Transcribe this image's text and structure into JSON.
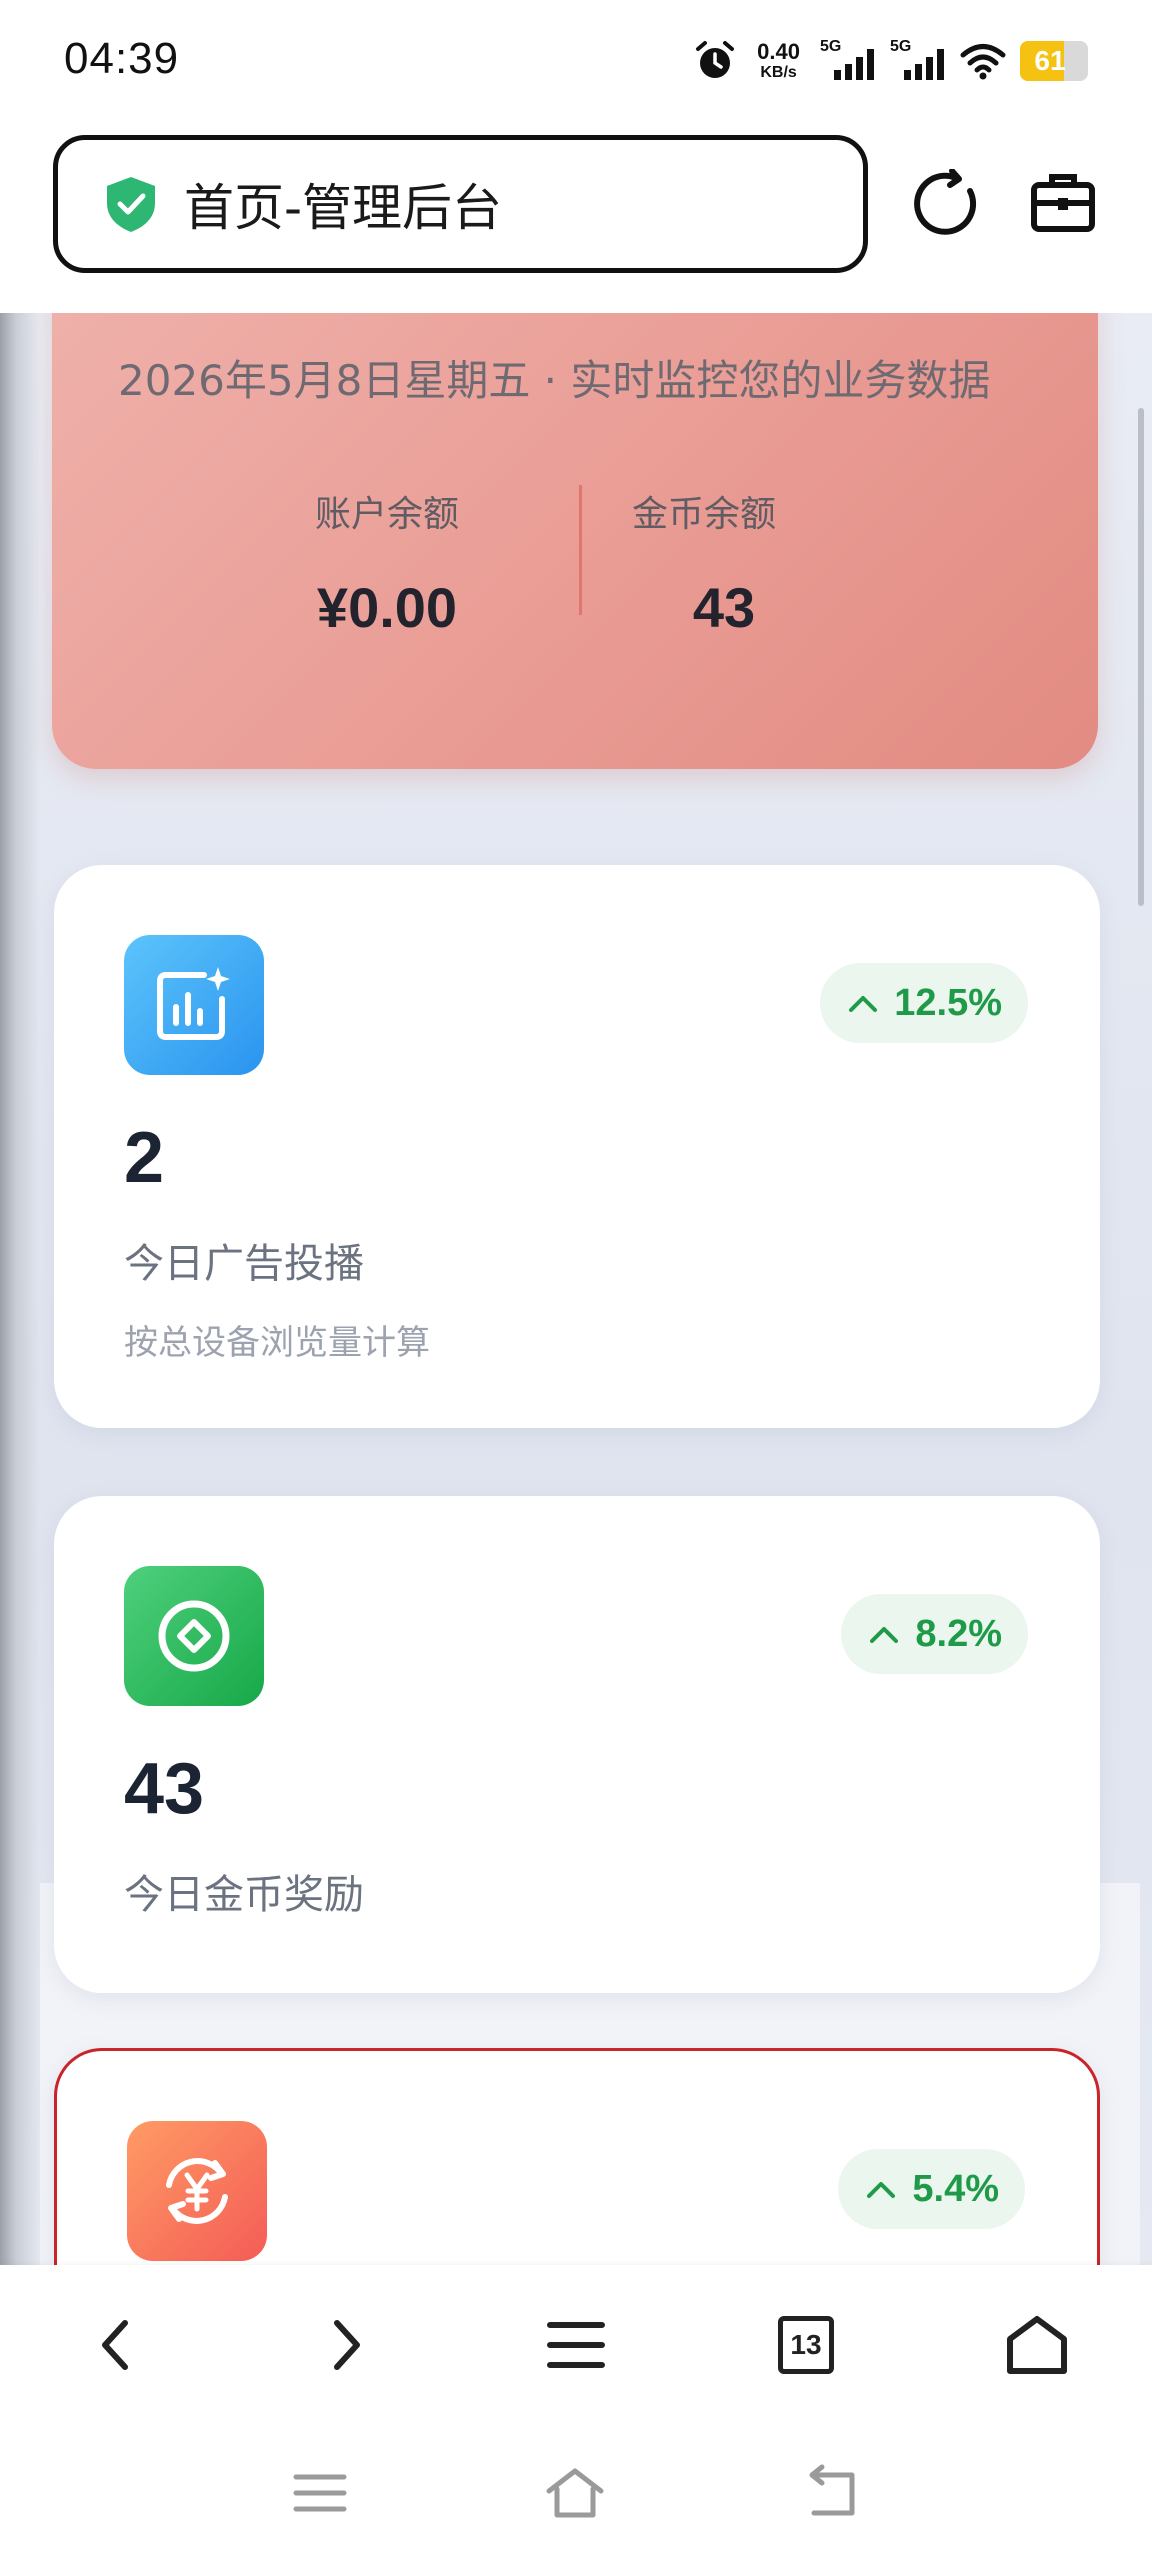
{
  "status_bar": {
    "time": "04:39",
    "net_speed_value": "0.40",
    "net_speed_unit": "KB/s",
    "signal_1_label": "5G",
    "signal_2_label": "5G",
    "battery_level": "61",
    "icons": [
      "alarm-icon",
      "signal-icon",
      "wifi-icon",
      "battery-icon"
    ]
  },
  "address_bar": {
    "title": "首页-管理后台",
    "icons": [
      "shield-check-icon",
      "refresh-icon",
      "toolbox-icon"
    ]
  },
  "hero": {
    "date_line": "2026年5月8日星期五 · 实时监控您的业务数据",
    "account_balance_label": "账户余额",
    "account_balance_value": "¥0.00",
    "coin_balance_label": "金币余额",
    "coin_balance_value": "43"
  },
  "stats": [
    {
      "icon": "chart-sparkle-icon",
      "trend": "12.5%",
      "value": "2",
      "label": "今日广告投播",
      "sub": "按总设备浏览量计算"
    },
    {
      "icon": "coin-icon",
      "trend": "8.2%",
      "value": "43",
      "label": "今日金币奖励"
    },
    {
      "icon": "yuan-exchange-icon",
      "trend": "5.4%"
    }
  ],
  "browser_toolbar": {
    "tab_count": "13",
    "icons": [
      "back-icon",
      "forward-icon",
      "menu-icon",
      "tabs-icon",
      "home-icon"
    ]
  },
  "system_nav": {
    "icons": [
      "recents-icon",
      "home-icon",
      "back-icon"
    ]
  },
  "colors": {
    "hero_gradient_start": "#efb1ab",
    "hero_gradient_end": "#e28b82",
    "trend_green": "#1f9a48",
    "alert_border": "#c8242a"
  }
}
